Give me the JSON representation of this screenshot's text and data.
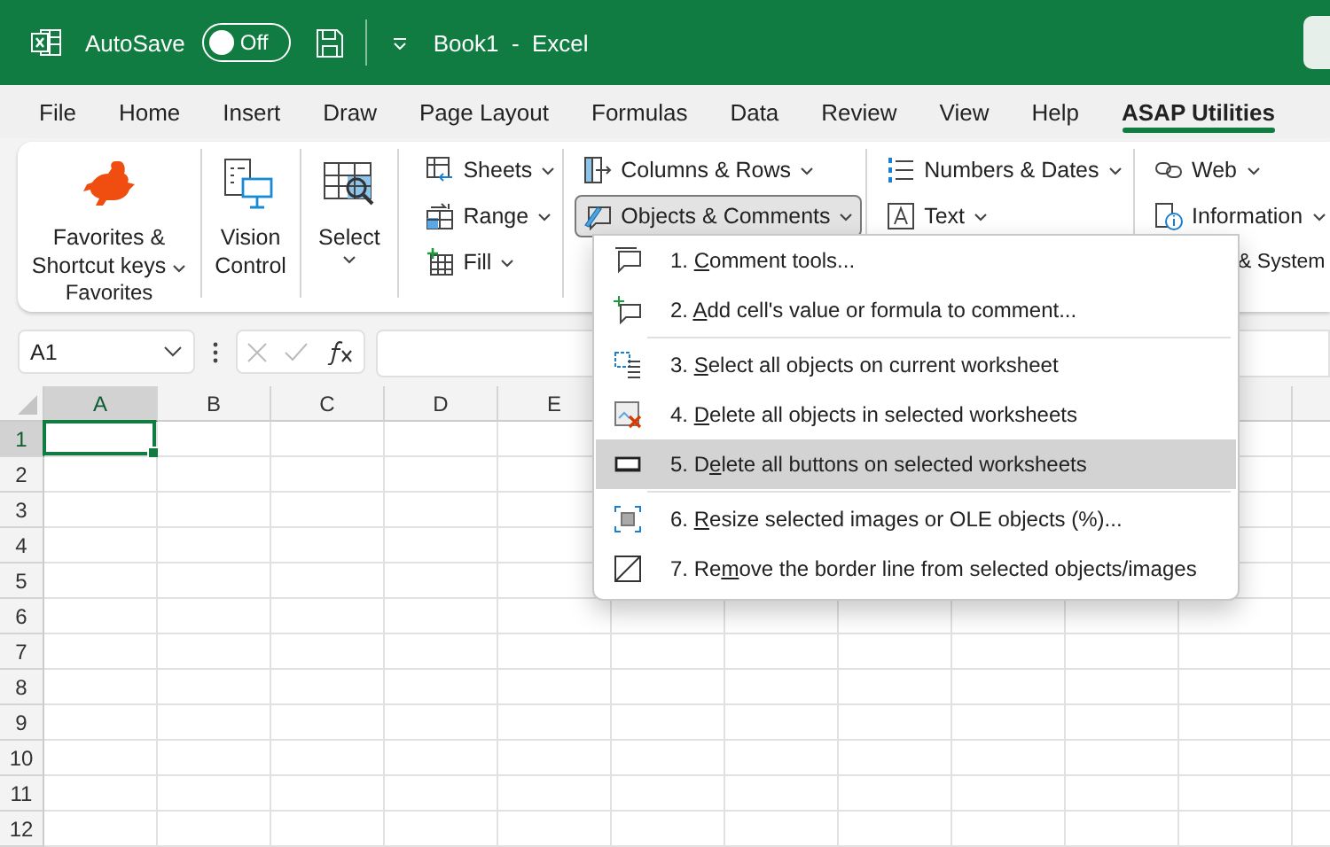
{
  "title_bar": {
    "autosave_label": "AutoSave",
    "autosave": {
      "on": false,
      "label": "Off"
    },
    "document_title": "Book1  -  Excel"
  },
  "tabs": [
    {
      "label": "File",
      "selected": false
    },
    {
      "label": "Home",
      "selected": false
    },
    {
      "label": "Insert",
      "selected": false
    },
    {
      "label": "Draw",
      "selected": false
    },
    {
      "label": "Page Layout",
      "selected": false
    },
    {
      "label": "Formulas",
      "selected": false
    },
    {
      "label": "Data",
      "selected": false
    },
    {
      "label": "Review",
      "selected": false
    },
    {
      "label": "View",
      "selected": false
    },
    {
      "label": "Help",
      "selected": false
    },
    {
      "label": "ASAP Utilities",
      "selected": true
    }
  ],
  "ribbon": {
    "group_label": "Favorites",
    "large_buttons": [
      {
        "lines": [
          "Favorites &",
          "Shortcut keys"
        ],
        "dropdown": true
      },
      {
        "lines": [
          "Vision",
          "Control"
        ],
        "dropdown": false
      },
      {
        "lines": [
          "Select"
        ],
        "dropdown": true
      }
    ],
    "columns": [
      {
        "items": [
          {
            "kind": "button",
            "label": "Sheets",
            "dropdown": true,
            "pressed": false
          },
          {
            "kind": "button",
            "label": "Range",
            "dropdown": true,
            "pressed": false
          },
          {
            "kind": "button",
            "label": "Fill",
            "dropdown": true,
            "pressed": false
          }
        ]
      },
      {
        "items": [
          {
            "kind": "button",
            "label": "Columns & Rows",
            "dropdown": true,
            "pressed": false
          },
          {
            "kind": "button",
            "label": "Objects & Comments",
            "dropdown": true,
            "pressed": true
          }
        ]
      },
      {
        "items": [
          {
            "kind": "button",
            "label": "Numbers & Dates",
            "dropdown": true,
            "pressed": false
          },
          {
            "kind": "button",
            "label": "Text",
            "dropdown": true,
            "pressed": false
          }
        ]
      },
      {
        "items": [
          {
            "kind": "button",
            "label": "Web",
            "dropdown": true,
            "pressed": false
          },
          {
            "kind": "button",
            "label": "Information",
            "dropdown": true,
            "pressed": false
          },
          {
            "kind": "clipped",
            "label": "& System",
            "dropdown": false
          }
        ]
      }
    ]
  },
  "formula_bar": {
    "name_box": "A1"
  },
  "grid": {
    "columns": [
      {
        "label": "A",
        "selected": true
      },
      {
        "label": "B",
        "selected": false
      },
      {
        "label": "C",
        "selected": false
      },
      {
        "label": "D",
        "selected": false
      },
      {
        "label": "E",
        "selected": false
      }
    ],
    "rows": [
      {
        "label": "1",
        "selected": true
      },
      {
        "label": "2",
        "selected": false
      },
      {
        "label": "3",
        "selected": false
      },
      {
        "label": "4",
        "selected": false
      },
      {
        "label": "5",
        "selected": false
      },
      {
        "label": "6",
        "selected": false
      },
      {
        "label": "7",
        "selected": false
      },
      {
        "label": "8",
        "selected": false
      },
      {
        "label": "9",
        "selected": false
      },
      {
        "label": "10",
        "selected": false
      },
      {
        "label": "11",
        "selected": false
      },
      {
        "label": "12",
        "selected": false
      }
    ]
  },
  "menu": {
    "groups": [
      {
        "items": [
          {
            "parts": [
              "1. ",
              "C",
              "omment tools..."
            ],
            "selected": false
          },
          {
            "parts": [
              "2. ",
              "A",
              "dd cell's value or formula to comment..."
            ],
            "selected": false
          }
        ]
      },
      {
        "items": [
          {
            "parts": [
              "3. ",
              "S",
              "elect all objects on current worksheet"
            ],
            "selected": false
          },
          {
            "parts": [
              "4. ",
              "D",
              "elete all objects in selected worksheets"
            ],
            "selected": false
          },
          {
            "parts": [
              "5. D",
              "e",
              "lete all buttons on selected worksheets"
            ],
            "selected": true
          }
        ]
      },
      {
        "items": [
          {
            "parts": [
              "6. ",
              "R",
              "esize selected images or OLE objects (%)..."
            ],
            "selected": false
          },
          {
            "parts": [
              "7. Re",
              "m",
              "ove the border line from selected objects/images"
            ],
            "selected": false
          }
        ]
      }
    ]
  }
}
